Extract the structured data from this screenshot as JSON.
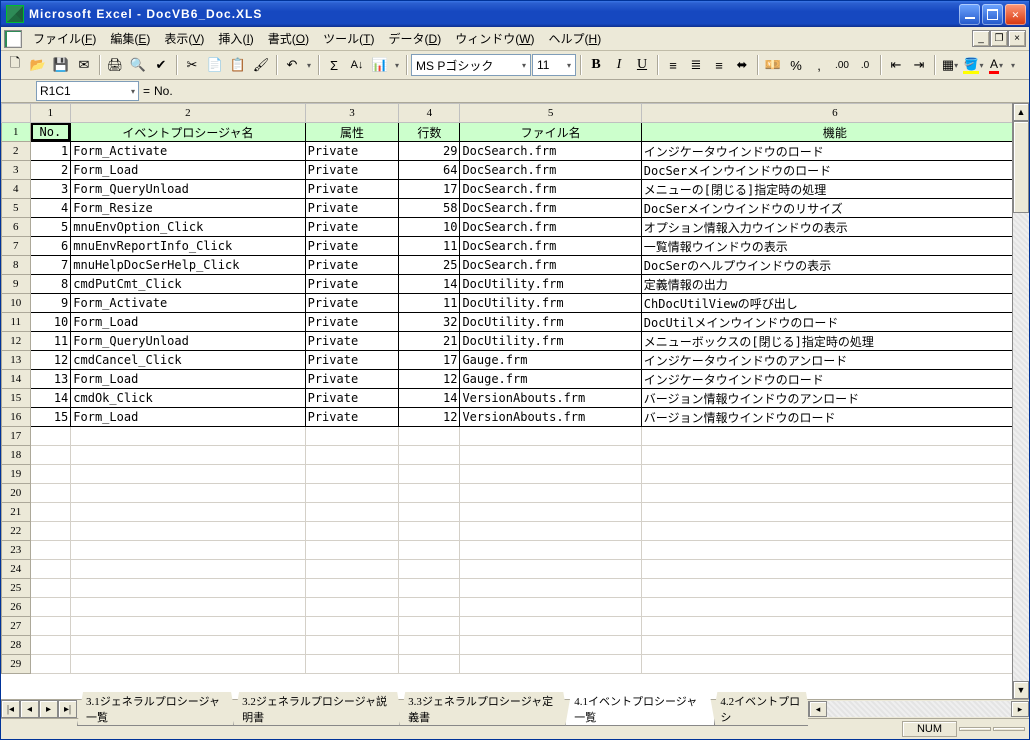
{
  "title": "Microsoft Excel - DocVB6_Doc.XLS",
  "menus": {
    "file": {
      "label": "ファイル",
      "accel": "F"
    },
    "edit": {
      "label": "編集",
      "accel": "E"
    },
    "view": {
      "label": "表示",
      "accel": "V"
    },
    "insert": {
      "label": "挿入",
      "accel": "I"
    },
    "format": {
      "label": "書式",
      "accel": "O"
    },
    "tools": {
      "label": "ツール",
      "accel": "T"
    },
    "data": {
      "label": "データ",
      "accel": "D"
    },
    "window": {
      "label": "ウィンドウ",
      "accel": "W"
    },
    "help": {
      "label": "ヘルプ",
      "accel": "H"
    }
  },
  "toolbar": {
    "font_name": "MS Pゴシック",
    "font_size": "11"
  },
  "namebox": "R1C1",
  "formula": "No.",
  "columns": {
    "c1": "1",
    "c2": "2",
    "c3": "3",
    "c4": "4",
    "c5": "5",
    "c6": "6"
  },
  "headers": {
    "no": "No.",
    "proc": "イベントプロシージャ名",
    "attr": "属性",
    "lines": "行数",
    "file": "ファイル名",
    "func": "機能"
  },
  "rows": [
    {
      "no": "1",
      "proc": "Form_Activate",
      "attr": "Private",
      "lines": "29",
      "file": "DocSearch.frm",
      "func": "インジケータウインドウのロード"
    },
    {
      "no": "2",
      "proc": "Form_Load",
      "attr": "Private",
      "lines": "64",
      "file": "DocSearch.frm",
      "func": "DocSerメインウインドウのロード"
    },
    {
      "no": "3",
      "proc": "Form_QueryUnload",
      "attr": "Private",
      "lines": "17",
      "file": "DocSearch.frm",
      "func": "メニューの[閉じる]指定時の処理"
    },
    {
      "no": "4",
      "proc": "Form_Resize",
      "attr": "Private",
      "lines": "58",
      "file": "DocSearch.frm",
      "func": "DocSerメインウインドウのリサイズ"
    },
    {
      "no": "5",
      "proc": "mnuEnvOption_Click",
      "attr": "Private",
      "lines": "10",
      "file": "DocSearch.frm",
      "func": "オプション情報入力ウインドウの表示"
    },
    {
      "no": "6",
      "proc": "mnuEnvReportInfo_Click",
      "attr": "Private",
      "lines": "11",
      "file": "DocSearch.frm",
      "func": "一覧情報ウインドウの表示"
    },
    {
      "no": "7",
      "proc": "mnuHelpDocSerHelp_Click",
      "attr": "Private",
      "lines": "25",
      "file": "DocSearch.frm",
      "func": "DocSerのヘルプウインドウの表示"
    },
    {
      "no": "8",
      "proc": "cmdPutCmt_Click",
      "attr": "Private",
      "lines": "14",
      "file": "DocUtility.frm",
      "func": "定義情報の出力"
    },
    {
      "no": "9",
      "proc": "Form_Activate",
      "attr": "Private",
      "lines": "11",
      "file": "DocUtility.frm",
      "func": "ChDocUtilViewの呼び出し"
    },
    {
      "no": "10",
      "proc": "Form_Load",
      "attr": "Private",
      "lines": "32",
      "file": "DocUtility.frm",
      "func": "DocUtilメインウインドウのロード"
    },
    {
      "no": "11",
      "proc": "Form_QueryUnload",
      "attr": "Private",
      "lines": "21",
      "file": "DocUtility.frm",
      "func": "メニューボックスの[閉じる]指定時の処理"
    },
    {
      "no": "12",
      "proc": "cmdCancel_Click",
      "attr": "Private",
      "lines": "17",
      "file": "Gauge.frm",
      "func": "インジケータウインドウのアンロード"
    },
    {
      "no": "13",
      "proc": "Form_Load",
      "attr": "Private",
      "lines": "12",
      "file": "Gauge.frm",
      "func": "インジケータウインドウのロード"
    },
    {
      "no": "14",
      "proc": "cmdOk_Click",
      "attr": "Private",
      "lines": "14",
      "file": "VersionAbouts.frm",
      "func": "バージョン情報ウインドウのアンロード"
    },
    {
      "no": "15",
      "proc": "Form_Load",
      "attr": "Private",
      "lines": "12",
      "file": "VersionAbouts.frm",
      "func": "バージョン情報ウインドウのロード"
    }
  ],
  "empty_row_start": 17,
  "empty_row_end": 29,
  "sheet_tabs": [
    {
      "label": "3.1ジェネラルプロシージャ一覧",
      "active": false
    },
    {
      "label": "3.2ジェネラルプロシージャ説明書",
      "active": false
    },
    {
      "label": "3.3ジェネラルプロシージャ定義書",
      "active": false
    },
    {
      "label": "4.1イベントプロシージャ一覧",
      "active": true
    },
    {
      "label": "4.2イベントプロシ",
      "active": false
    }
  ],
  "status": {
    "num": "NUM"
  }
}
